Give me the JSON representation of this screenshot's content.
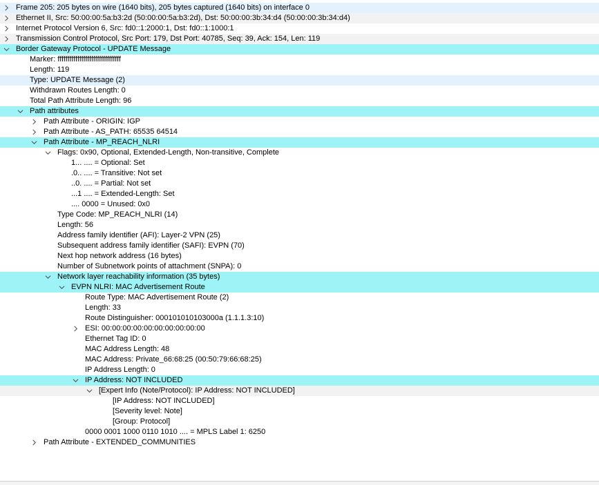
{
  "packet_details": {
    "rows": [
      {
        "text": "Frame 205: 205 bytes on wire (1640 bits), 205 bytes captured (1640 bits) on interface 0",
        "depth": 0,
        "expander": "collapsed",
        "style": "sel"
      },
      {
        "text": "Ethernet II, Src: 50:00:00:5a:b3:2d (50:00:00:5a:b3:2d), Dst: 50:00:00:3b:34:d4 (50:00:00:3b:34:d4)",
        "depth": 0,
        "expander": "collapsed",
        "style": "gray"
      },
      {
        "text": "Internet Protocol Version 6, Src: fd0::1:2000:1, Dst: fd0::1:1000:1",
        "depth": 0,
        "expander": "collapsed",
        "style": ""
      },
      {
        "text": "Transmission Control Protocol, Src Port: 179, Dst Port: 40785, Seq: 39, Ack: 154, Len: 119",
        "depth": 0,
        "expander": "collapsed",
        "style": "gray"
      },
      {
        "text": "Border Gateway Protocol - UPDATE Message",
        "depth": 0,
        "expander": "expanded",
        "style": "hl"
      },
      {
        "text": "Marker: ffffffffffffffffffffffffffffffff",
        "depth": 1,
        "expander": "none",
        "style": ""
      },
      {
        "text": "Length: 119",
        "depth": 1,
        "expander": "none",
        "style": ""
      },
      {
        "text": "Type: UPDATE Message (2)",
        "depth": 1,
        "expander": "none",
        "style": "sel"
      },
      {
        "text": "Withdrawn Routes Length: 0",
        "depth": 1,
        "expander": "none",
        "style": ""
      },
      {
        "text": "Total Path Attribute Length: 96",
        "depth": 1,
        "expander": "none",
        "style": ""
      },
      {
        "text": "Path attributes",
        "depth": 1,
        "expander": "expanded",
        "style": "hl"
      },
      {
        "text": "Path Attribute - ORIGIN: IGP",
        "depth": 2,
        "expander": "collapsed",
        "style": ""
      },
      {
        "text": "Path Attribute - AS_PATH: 65535 64514",
        "depth": 2,
        "expander": "collapsed",
        "style": ""
      },
      {
        "text": "Path Attribute - MP_REACH_NLRI",
        "depth": 2,
        "expander": "expanded",
        "style": "hl"
      },
      {
        "text": "Flags: 0x90, Optional, Extended-Length, Non-transitive, Complete",
        "depth": 3,
        "expander": "expanded",
        "style": ""
      },
      {
        "text": "1... .... = Optional: Set",
        "depth": 4,
        "expander": "none",
        "style": ""
      },
      {
        "text": ".0.. .... = Transitive: Not set",
        "depth": 4,
        "expander": "none",
        "style": ""
      },
      {
        "text": "..0. .... = Partial: Not set",
        "depth": 4,
        "expander": "none",
        "style": ""
      },
      {
        "text": "...1 .... = Extended-Length: Set",
        "depth": 4,
        "expander": "none",
        "style": ""
      },
      {
        "text": ".... 0000 = Unused: 0x0",
        "depth": 4,
        "expander": "none",
        "style": ""
      },
      {
        "text": "Type Code: MP_REACH_NLRI (14)",
        "depth": 3,
        "expander": "none",
        "style": ""
      },
      {
        "text": "Length: 56",
        "depth": 3,
        "expander": "none",
        "style": ""
      },
      {
        "text": "Address family identifier (AFI): Layer-2 VPN (25)",
        "depth": 3,
        "expander": "none",
        "style": ""
      },
      {
        "text": "Subsequent address family identifier (SAFI): EVPN (70)",
        "depth": 3,
        "expander": "none",
        "style": ""
      },
      {
        "text": "Next hop network address (16 bytes)",
        "depth": 3,
        "expander": "none",
        "style": ""
      },
      {
        "text": "Number of Subnetwork points of attachment (SNPA): 0",
        "depth": 3,
        "expander": "none",
        "style": ""
      },
      {
        "text": "Network layer reachability information (35 bytes)",
        "depth": 3,
        "expander": "expanded",
        "style": "hl"
      },
      {
        "text": "EVPN NLRI: MAC Advertisement Route",
        "depth": 4,
        "expander": "expanded",
        "style": "hl"
      },
      {
        "text": "Route Type: MAC Advertisement Route (2)",
        "depth": 5,
        "expander": "none",
        "style": ""
      },
      {
        "text": "Length: 33",
        "depth": 5,
        "expander": "none",
        "style": ""
      },
      {
        "text": "Route Distinguisher: 000101010103000a (1.1.1.3:10)",
        "depth": 5,
        "expander": "none",
        "style": ""
      },
      {
        "text": "ESI: 00:00:00:00:00:00:00:00:00:00",
        "depth": 5,
        "expander": "collapsed",
        "style": ""
      },
      {
        "text": "Ethernet Tag ID: 0",
        "depth": 5,
        "expander": "none",
        "style": ""
      },
      {
        "text": "MAC Address Length: 48",
        "depth": 5,
        "expander": "none",
        "style": ""
      },
      {
        "text": "MAC Address: Private_66:68:25 (00:50:79:66:68:25)",
        "depth": 5,
        "expander": "none",
        "style": ""
      },
      {
        "text": "IP Address Length: 0",
        "depth": 5,
        "expander": "none",
        "style": ""
      },
      {
        "text": "IP Address: NOT INCLUDED",
        "depth": 5,
        "expander": "expanded",
        "style": "hl"
      },
      {
        "text": "[Expert Info (Note/Protocol): IP Address: NOT INCLUDED]",
        "depth": 6,
        "expander": "expanded",
        "style": "gray"
      },
      {
        "text": "[IP Address: NOT INCLUDED]",
        "depth": 7,
        "expander": "none",
        "style": ""
      },
      {
        "text": "[Severity level: Note]",
        "depth": 7,
        "expander": "none",
        "style": ""
      },
      {
        "text": "[Group: Protocol]",
        "depth": 7,
        "expander": "none",
        "style": ""
      },
      {
        "text": "0000 0001 1000 0110 1010 .... = MPLS Label 1: 6250",
        "depth": 5,
        "expander": "none",
        "style": ""
      },
      {
        "text": "Path Attribute - EXTENDED_COMMUNITIES",
        "depth": 2,
        "expander": "collapsed",
        "style": ""
      }
    ]
  },
  "icons": {
    "collapsed": "chevron-right-icon",
    "expanded": "chevron-down-icon"
  },
  "colors": {
    "highlight": "#9ef3f6",
    "selected": "#e2f1fc",
    "alternate": "#f2f2f2",
    "chevron": "#555555"
  }
}
